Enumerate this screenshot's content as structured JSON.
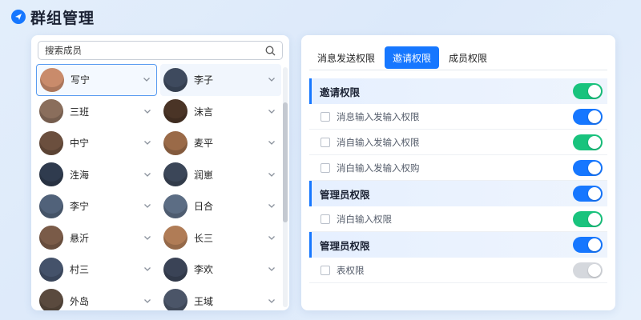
{
  "app": {
    "title": "群组管理"
  },
  "search": {
    "placeholder": "搜索成员"
  },
  "colors": {
    "accent": "#1677ff",
    "green": "#19c37d",
    "grey": "#d5d8dd"
  },
  "members": [
    {
      "name": "写宁",
      "avatar_color": "#c98b6b",
      "selected": true
    },
    {
      "name": "李子",
      "avatar_color": "#3e4a5e",
      "hover": true
    },
    {
      "name": "三班",
      "avatar_color": "#8a6e5c"
    },
    {
      "name": "沫言",
      "avatar_color": "#4a3426"
    },
    {
      "name": "中宁",
      "avatar_color": "#6b4f3e"
    },
    {
      "name": "麦平",
      "avatar_color": "#9a6a48"
    },
    {
      "name": "泩海",
      "avatar_color": "#2f3b4e"
    },
    {
      "name": "润崽",
      "avatar_color": "#3b4658"
    },
    {
      "name": "李宁",
      "avatar_color": "#51627a"
    },
    {
      "name": "日合",
      "avatar_color": "#5c6d84"
    },
    {
      "name": "悬沂",
      "avatar_color": "#7a5b48"
    },
    {
      "name": "长三",
      "avatar_color": "#b07c56"
    },
    {
      "name": "村三",
      "avatar_color": "#44526a"
    },
    {
      "name": "李欢",
      "avatar_color": "#3a4356"
    },
    {
      "name": "外岛",
      "avatar_color": "#5a4a3e"
    },
    {
      "name": "王域",
      "avatar_color": "#4b5568"
    }
  ],
  "tabs": [
    {
      "label": "消息发送权限",
      "active": false
    },
    {
      "label": "邀请权限",
      "active": true
    },
    {
      "label": "成员权限",
      "active": false
    }
  ],
  "permissions": [
    {
      "type": "section",
      "label": "邀请权限",
      "toggle": "green"
    },
    {
      "type": "item",
      "label": "消息输入发输入权限",
      "toggle": "blue"
    },
    {
      "type": "item",
      "label": "消自输入发输入权限",
      "toggle": "green"
    },
    {
      "type": "item",
      "label": "消白输入发输入权购",
      "toggle": "blue"
    },
    {
      "type": "section",
      "label": "管理员权限",
      "toggle": "blue"
    },
    {
      "type": "item",
      "label": "消白输入权限",
      "toggle": "green"
    },
    {
      "type": "section",
      "label": "管理员权限",
      "toggle": "blue"
    },
    {
      "type": "item",
      "label": "表权限",
      "toggle": "grey"
    }
  ]
}
